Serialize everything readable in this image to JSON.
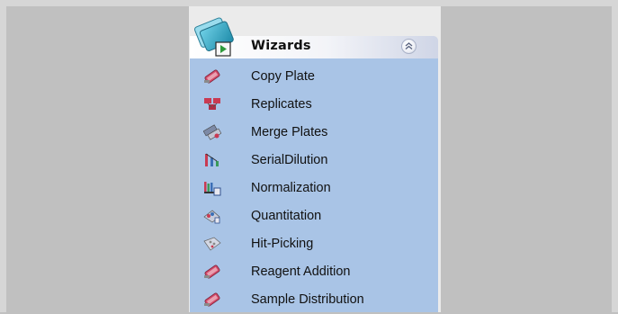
{
  "panel": {
    "header": {
      "title": "Wizards",
      "logo_icon": "wizards-icon",
      "collapse_icon": "double-chevron-up-icon"
    },
    "items": [
      {
        "label": "Copy Plate",
        "icon": "copy-plate-icon"
      },
      {
        "label": "Replicates",
        "icon": "replicates-icon"
      },
      {
        "label": "Merge Plates",
        "icon": "merge-plates-icon"
      },
      {
        "label": "SerialDilution",
        "icon": "serial-dilution-icon"
      },
      {
        "label": "Normalization",
        "icon": "normalization-icon"
      },
      {
        "label": "Quantitation",
        "icon": "quantitation-icon"
      },
      {
        "label": "Hit-Picking",
        "icon": "hit-picking-icon"
      },
      {
        "label": "Reagent Addition",
        "icon": "reagent-addition-icon"
      },
      {
        "label": "Sample Distribution",
        "icon": "sample-distribution-icon"
      }
    ]
  },
  "colors": {
    "background": "#c0c0c0",
    "panel_body": "#a9c4e6",
    "header_gradient_end": "#cfd5e6"
  }
}
